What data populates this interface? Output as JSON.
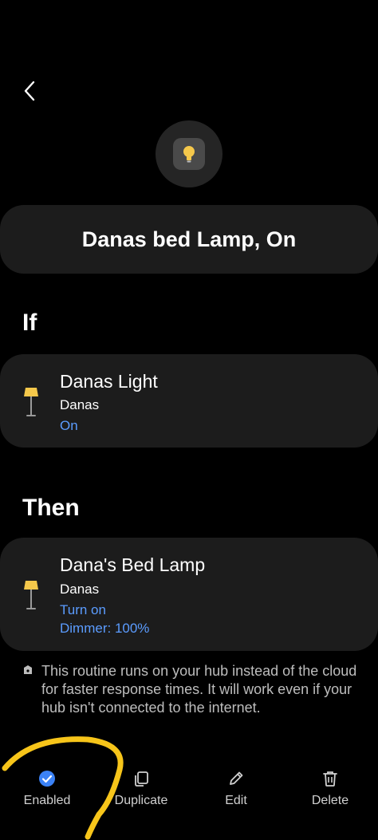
{
  "header": {
    "back_icon": "chevron-left-icon",
    "device_icon": "lightbulb-icon"
  },
  "routine": {
    "title": "Danas bed Lamp, On"
  },
  "if_section": {
    "heading": "If",
    "device": {
      "icon": "floor-lamp-icon",
      "name": "Danas Light",
      "room": "Danas",
      "state": "On"
    }
  },
  "then_section": {
    "heading": "Then",
    "device": {
      "icon": "floor-lamp-icon",
      "name": "Dana's Bed Lamp",
      "room": "Danas",
      "action_1": "Turn on",
      "action_2": "Dimmer: 100%"
    }
  },
  "hub_note": {
    "icon": "hub-icon",
    "text": "This routine runs on your hub instead of the cloud for faster response times. It will work even if your hub isn't connected to the internet."
  },
  "bottom_actions": [
    {
      "label": "Enabled",
      "icon": "check-circle-icon"
    },
    {
      "label": "Duplicate",
      "icon": "duplicate-icon"
    },
    {
      "label": "Edit",
      "icon": "pencil-icon"
    },
    {
      "label": "Delete",
      "icon": "trash-icon"
    }
  ],
  "colors": {
    "background": "#000000",
    "card": "#1c1c1c",
    "accent_blue": "#5b9cff",
    "enabled_blue": "#3b82f6",
    "lamp_yellow": "#f5c84b",
    "annotation_yellow": "#f7c51a"
  }
}
